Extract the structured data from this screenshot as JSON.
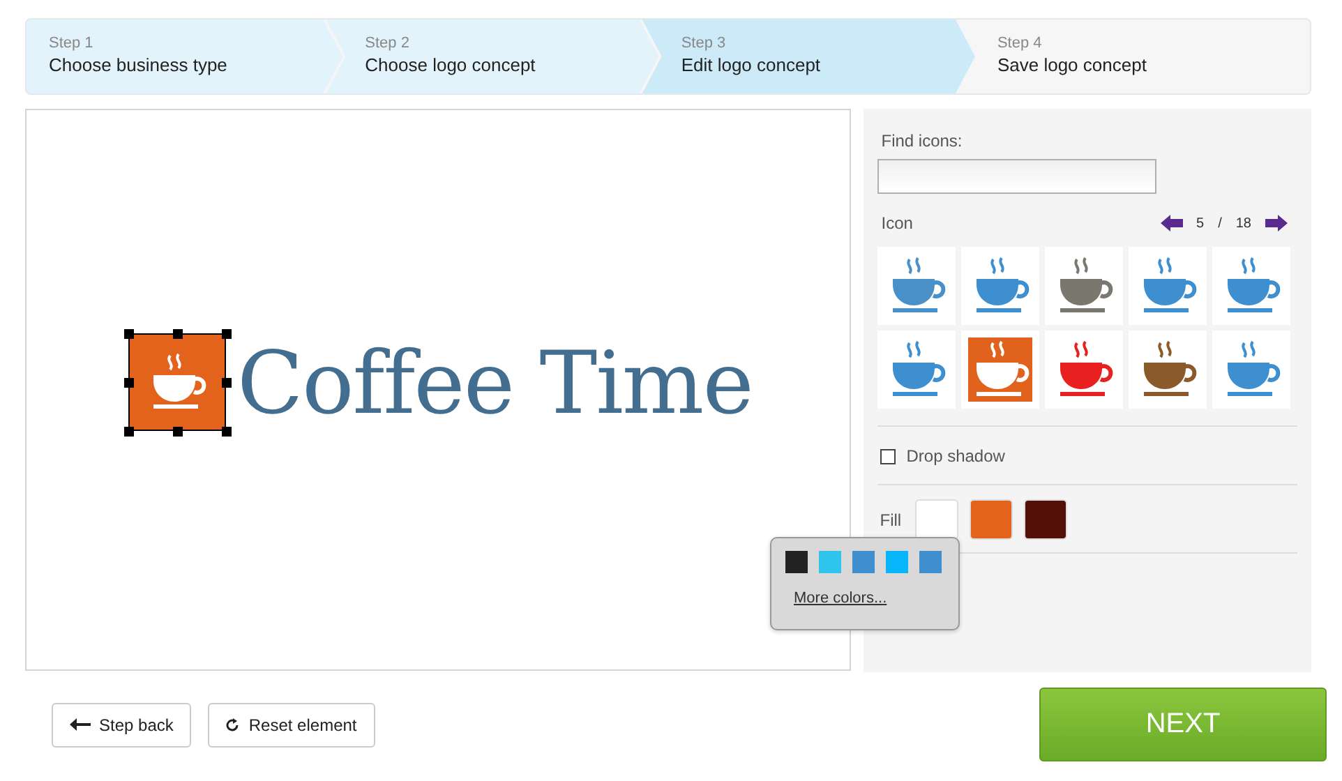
{
  "steps": [
    {
      "number": "Step 1",
      "label": "Choose business type",
      "completed": true,
      "selected": false
    },
    {
      "number": "Step 2",
      "label": "Choose logo concept",
      "completed": true,
      "selected": false
    },
    {
      "number": "Step 3",
      "label": "Edit logo concept",
      "completed": false,
      "selected": true
    },
    {
      "number": "Step 4",
      "label": "Save logo concept",
      "completed": false,
      "selected": false
    }
  ],
  "canvas": {
    "logo_text": "Coffee Time",
    "icon_selected": true
  },
  "panel": {
    "find_label": "Find icons:",
    "icon_label": "Icon",
    "page": "5",
    "separator": "/",
    "total": "18",
    "icons": [
      {
        "color": "#4a90c8",
        "selected": false
      },
      {
        "color": "#3d8fcf",
        "selected": false
      },
      {
        "color": "#7a776e",
        "selected": false
      },
      {
        "color": "#3d8fcf",
        "selected": false
      },
      {
        "color": "#3d8fcf",
        "selected": false
      },
      {
        "color": "#3d8fcf",
        "selected": false
      },
      {
        "color": "#e0621c",
        "selected": true
      },
      {
        "color": "#e82020",
        "selected": false
      },
      {
        "color": "#8a5a2a",
        "selected": false
      },
      {
        "color": "#3d8fcf",
        "selected": false
      }
    ],
    "drop_shadow": {
      "label": "Drop shadow",
      "checked": false
    },
    "fill": {
      "label": "Fill",
      "swatches": [
        {
          "color": "#ffffff"
        },
        {
          "color": "#e3621c"
        },
        {
          "color": "#541008"
        }
      ]
    }
  },
  "color_popup": {
    "swatches": [
      {
        "color": "#222222"
      },
      {
        "color": "#2fc4ee"
      },
      {
        "color": "#3f8fcf"
      },
      {
        "color": "#08b4fa"
      },
      {
        "color": "#3f8fcf"
      }
    ],
    "link": "More colors..."
  },
  "buttons": {
    "back": "Step back",
    "reset": "Reset element",
    "next": "NEXT"
  }
}
